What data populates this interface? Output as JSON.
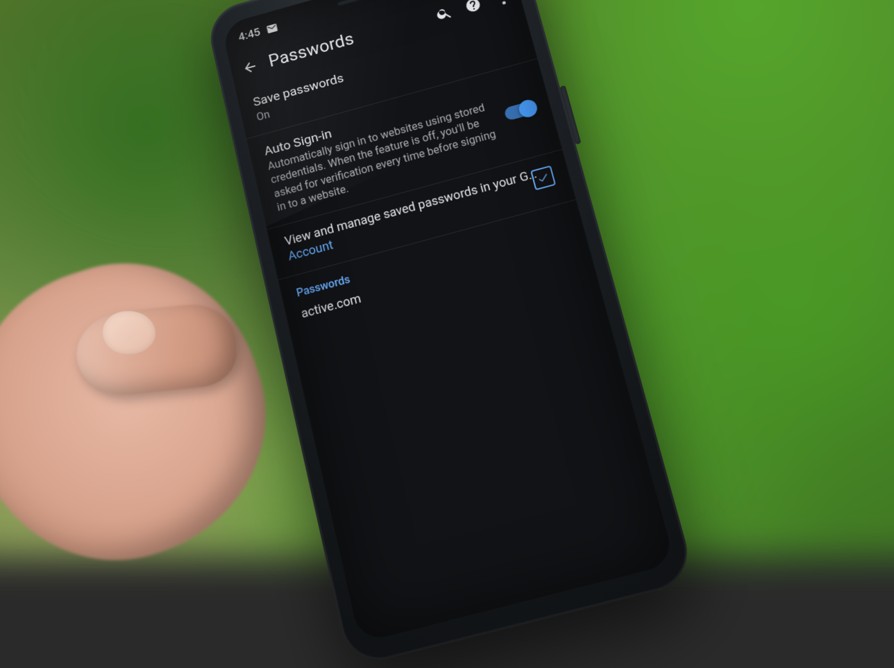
{
  "status_bar": {
    "time": "4:45",
    "icons_left": [
      "mail-icon"
    ],
    "icons_right": [
      "bell-muted-icon",
      "wifi-icon",
      "cell-signal-icon",
      "battery-icon"
    ]
  },
  "app_bar": {
    "title": "Passwords",
    "search_icon": "search-icon",
    "help_icon": "help-icon",
    "overflow_icon": "overflow-menu-icon"
  },
  "settings": {
    "save_passwords": {
      "title": "Save passwords",
      "value": "On"
    },
    "auto_sign_in": {
      "title": "Auto Sign-in",
      "description": "Automatically sign in to websites using stored credentials. When the feature is off, you'll be asked for verification every time before signing in to a website.",
      "toggle_on": true
    },
    "manage": {
      "text_pre": "View and manage saved passwords in your G…",
      "link_label": "Account",
      "external_icon": "open-external-icon"
    }
  },
  "passwords_section": {
    "header": "Passwords",
    "entries": [
      "active.com"
    ]
  },
  "colors": {
    "accent": "#4aa0ff",
    "link": "#6ab0ff",
    "screen_bg": "#121316",
    "text_primary": "#e8eaed",
    "text_secondary": "#a9adb1"
  }
}
